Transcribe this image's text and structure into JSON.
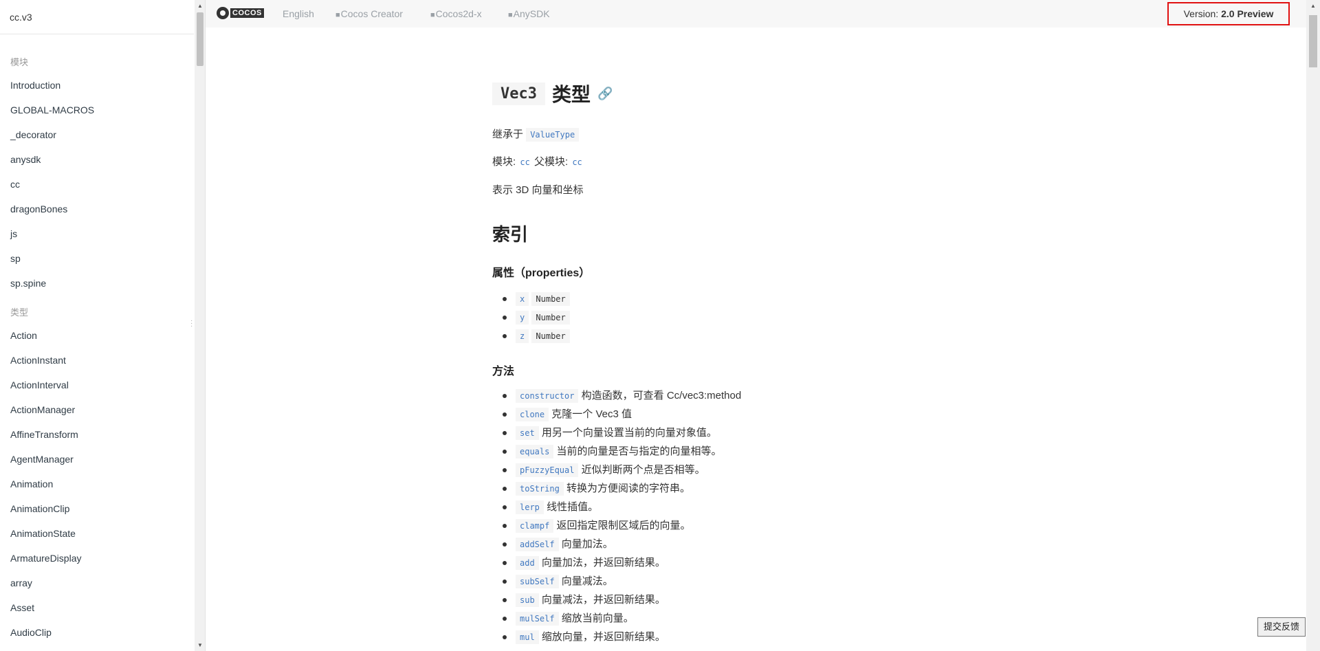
{
  "sidebar": {
    "header": "cc.v3",
    "section_modules": "模块",
    "modules": [
      "Introduction",
      "GLOBAL-MACROS",
      "_decorator",
      "anysdk",
      "cc",
      "dragonBones",
      "js",
      "sp",
      "sp.spine"
    ],
    "section_types": "类型",
    "types": [
      "Action",
      "ActionInstant",
      "ActionInterval",
      "ActionManager",
      "AffineTransform",
      "AgentManager",
      "Animation",
      "AnimationClip",
      "AnimationState",
      "ArmatureDisplay",
      "array",
      "Asset",
      "AudioClip"
    ]
  },
  "topnav": {
    "logo_text": "COCOS",
    "links": [
      "English",
      "Cocos Creator",
      "Cocos2d-x",
      "AnySDK"
    ],
    "version_label": "Version:",
    "version_value": "2.0 Preview"
  },
  "content": {
    "title_code": "Vec3",
    "title_text": "类型",
    "inherit_label": "继承于",
    "inherit_value": "ValueType",
    "module_label": "模块:",
    "module_value": "cc",
    "parent_label": "父模块:",
    "parent_value": "cc",
    "description": "表示 3D 向量和坐标",
    "index_heading": "索引",
    "props_heading": "属性（properties）",
    "properties": [
      {
        "name": "x",
        "type": "Number"
      },
      {
        "name": "y",
        "type": "Number"
      },
      {
        "name": "z",
        "type": "Number"
      }
    ],
    "methods_heading": "方法",
    "methods": [
      {
        "name": "constructor",
        "desc": "构造函数，可查看 Cc/vec3:method"
      },
      {
        "name": "clone",
        "desc": "克隆一个 Vec3 值"
      },
      {
        "name": "set",
        "desc": "用另一个向量设置当前的向量对象值。"
      },
      {
        "name": "equals",
        "desc": "当前的向量是否与指定的向量相等。"
      },
      {
        "name": "pFuzzyEqual",
        "desc": "近似判断两个点是否相等。"
      },
      {
        "name": "toString",
        "desc": "转换为方便阅读的字符串。"
      },
      {
        "name": "lerp",
        "desc": "线性插值。"
      },
      {
        "name": "clampf",
        "desc": "返回指定限制区域后的向量。"
      },
      {
        "name": "addSelf",
        "desc": "向量加法。"
      },
      {
        "name": "add",
        "desc": "向量加法，并返回新结果。"
      },
      {
        "name": "subSelf",
        "desc": "向量减法。"
      },
      {
        "name": "sub",
        "desc": "向量减法，并返回新结果。"
      },
      {
        "name": "mulSelf",
        "desc": "缩放当前向量。"
      },
      {
        "name": "mul",
        "desc": "缩放向量，并返回新结果。"
      }
    ]
  },
  "feedback_button": "提交反馈"
}
